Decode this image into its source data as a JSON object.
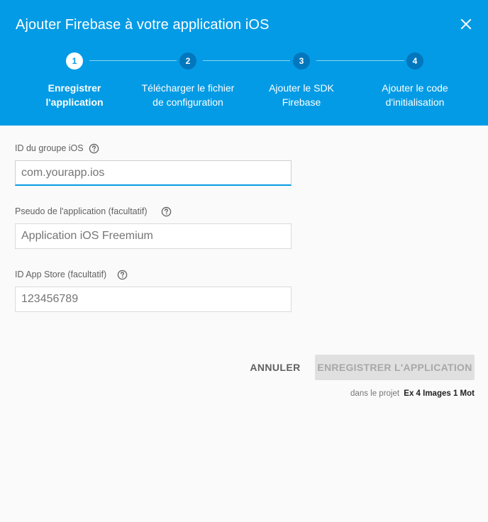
{
  "dialog": {
    "title": "Ajouter Firebase à votre application iOS",
    "close_icon": "close-icon"
  },
  "stepper": {
    "steps": [
      {
        "number": "1",
        "label": "Enregistrer\nl'application",
        "active": true
      },
      {
        "number": "2",
        "label": "Télécharger le fichier\nde configuration",
        "active": false
      },
      {
        "number": "3",
        "label": "Ajouter le SDK\nFirebase",
        "active": false
      },
      {
        "number": "4",
        "label": "Ajouter le code\nd'initialisation",
        "active": false
      }
    ]
  },
  "form": {
    "bundle_id": {
      "label": "ID du groupe iOS",
      "placeholder": "com.yourapp.ios",
      "value": "",
      "help_icon": "help-circle-icon"
    },
    "nickname": {
      "label": "Pseudo de l'application (facultatif)",
      "placeholder": "Application iOS Freemium",
      "value": "",
      "help_icon": "help-circle-icon"
    },
    "app_store_id": {
      "label": "ID App Store (facultatif)",
      "placeholder": "123456789",
      "value": "",
      "help_icon": "help-circle-icon"
    }
  },
  "actions": {
    "cancel_label": "ANNULER",
    "register_label": "ENREGISTRER L'APPLICATION"
  },
  "project": {
    "prefix": "dans le projet",
    "name": "Ex 4 Images 1 Mot"
  },
  "colors": {
    "header": "#039be5",
    "step_inactive": "#0277bd",
    "focus_underline": "#039be5",
    "disabled_button": "#e0e0e0"
  }
}
